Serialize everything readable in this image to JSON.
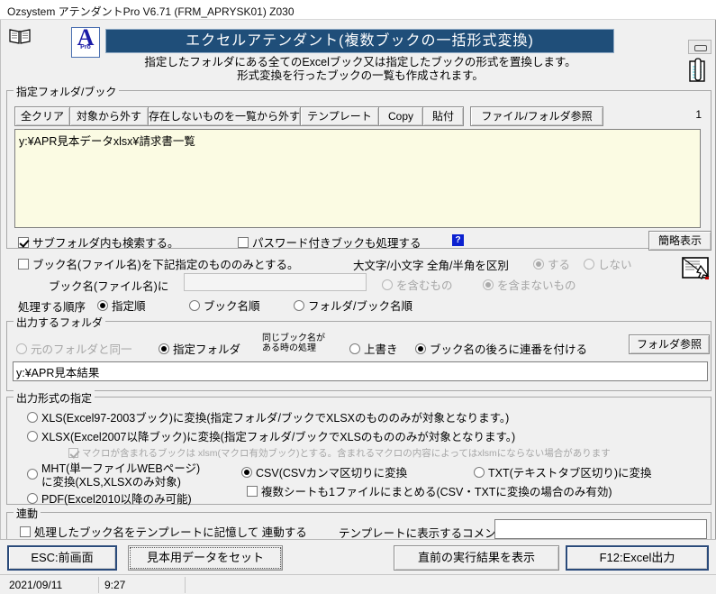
{
  "window": {
    "title": "Ozsystem アテンダントPro V6.71 (FRM_APRYSK01) Z030",
    "minimize_button": "minimize"
  },
  "header": {
    "logo_letter": "A",
    "logo_sub": "Pro",
    "banner_title": "エクセルアテンダント(複数ブックの一括形式変換)",
    "subtitle_line1": "指定したフォルダにある全てのExcelブック又は指定したブックの形式を置換します。",
    "subtitle_line2": "形式変換を行ったブックの一覧も作成されます。"
  },
  "folder_group": {
    "legend": "指定フォルダ/ブック",
    "buttons": [
      {
        "label": "全クリア",
        "width": 62
      },
      {
        "label": "対象から外す",
        "width": 88
      },
      {
        "label": "存在しないものを一覧から外す",
        "width": 170
      },
      {
        "label": "テンプレート",
        "width": 88
      },
      {
        "label": "Copy",
        "width": 50
      },
      {
        "label": "貼付",
        "width": 46
      },
      {
        "label": "ファイル/フォルダ参照",
        "width": 148
      }
    ],
    "counter": "1",
    "list_items": [
      "y:¥APR見本データxlsx¥請求書一覧"
    ],
    "subfolder_check": {
      "label": "サブフォルダ内も検索する。",
      "checked": true
    },
    "password_check": {
      "label": "パスワード付きブックも処理する",
      "checked": false
    },
    "help_icon_text": "?",
    "simple_view_button": "簡略表示",
    "bookname_filter_check": {
      "label": "ブック名(ファイル名)を下記指定のもののみとする。",
      "checked": false
    },
    "case_label": "大文字/小文字 全角/半角を区別",
    "case_options": [
      {
        "label": "する",
        "selected": true,
        "disabled": true
      },
      {
        "label": "しない",
        "selected": false,
        "disabled": true
      }
    ],
    "bookname_input_label": "ブック名(ファイル名)に",
    "bookname_input_value": "",
    "contains_options": [
      {
        "label": "を含むもの",
        "selected": false,
        "disabled": true
      },
      {
        "label": "を含まないもの",
        "selected": true,
        "disabled": true
      }
    ],
    "order_label": "処理する順序",
    "order_options": [
      {
        "label": "指定順",
        "selected": true
      },
      {
        "label": "ブック名順",
        "selected": false
      },
      {
        "label": "フォルダ/ブック名順",
        "selected": false
      }
    ]
  },
  "output_folder_group": {
    "legend": "出力するフォルダ",
    "dest_options": [
      {
        "label": "元のフォルダと同一",
        "selected": false
      },
      {
        "label": "指定フォルダ",
        "selected": true
      }
    ],
    "duplicate_label_line1": "同じブック名が",
    "duplicate_label_line2": "ある時の処理",
    "duplicate_options": [
      {
        "label": "上書き",
        "selected": false
      },
      {
        "label": "ブック名の後ろに連番を付ける",
        "selected": true
      }
    ],
    "browse_button": "フォルダ参照",
    "path_value": "y:¥APR見本結果"
  },
  "output_format_group": {
    "legend": "出力形式の指定",
    "options": [
      {
        "label": "XLS(Excel97-2003ブック)に変換(指定フォルダ/ブックでXLSXのもののみが対象となります。)",
        "selected": false
      },
      {
        "label": "XLSX(Excel2007以降ブック)に変換(指定フォルダ/ブックでXLSのもののみが対象となります。)",
        "selected": false
      }
    ],
    "macro_check": {
      "label": "マクロが含まれるブックは xlsm(マクロ有効ブック)とする。含まれるマクロの内容によってはxlsmにならない場合があります",
      "checked": true,
      "disabled": true
    },
    "mht_option": {
      "label_line1": "MHT(単一ファイルWEBページ)",
      "label_line2": "に変換(XLS,XLSXのみ対象)",
      "selected": false
    },
    "pdf_option": {
      "label": "PDF(Excel2010以降のみ可能)",
      "selected": false
    },
    "csv_option": {
      "label": "CSV(CSVカンマ区切りに変換",
      "selected": true
    },
    "txt_option": {
      "label": "TXT(テキストタブ区切り)に変換",
      "selected": false
    },
    "merge_check": {
      "label": "複数シートも1ファイルにまとめる(CSV・TXTに変換の場合のみ有効)",
      "checked": false
    }
  },
  "link_group": {
    "legend": "連動",
    "link_check": {
      "label": "処理したブック名をテンプレートに記憶して 連動する",
      "checked": false
    },
    "comment_label": "テンプレートに表示するコメント",
    "comment_value": ""
  },
  "footer": {
    "esc_button": "ESC:前画面",
    "sample_button": "見本用データをセット",
    "last_result_button": "直前の実行結果を表示",
    "excel_output_button": "F12:Excel出力"
  },
  "statusbar": {
    "date": "2021/09/11",
    "time": "9:27",
    "message": ""
  },
  "colors": {
    "banner_bg": "#1f4e79",
    "accent": "#1c1ca8",
    "list_bg": "#fbfbe3",
    "help_bg": "#0b21d0"
  }
}
